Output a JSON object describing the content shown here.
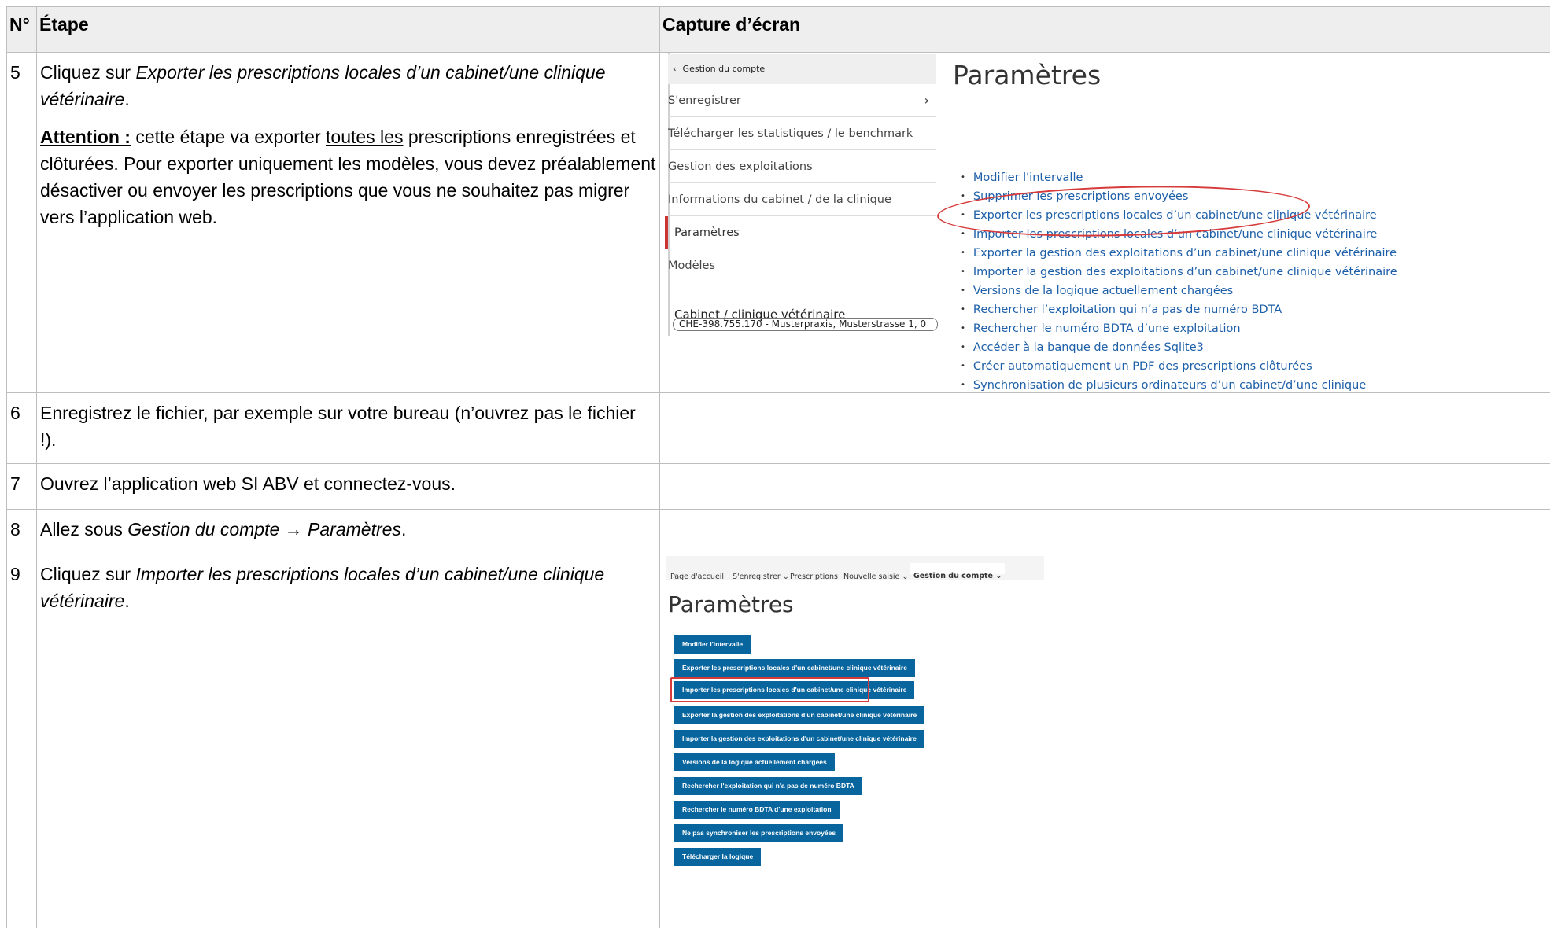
{
  "table": {
    "headers": {
      "num": "N°",
      "step": "Étape",
      "screenshot": "Capture d’écran"
    },
    "rows": [
      {
        "num": "5",
        "step_pre": "Cliquez sur ",
        "step_em": "Exporter les prescriptions locales d’un cabinet/une clinique vétérinaire",
        "step_post": ".",
        "attention_label": "Attention :",
        "attention_text_a": " cette étape va exporter ",
        "attention_underline": "toutes les",
        "attention_text_b": " prescriptions enregistrées et clôturées. Pour exporter uniquement les modèles, vous devez préalablement désactiver ou envoyer les prescriptions que vous ne souhaitez pas migrer vers l’application web."
      },
      {
        "num": "6",
        "step": "Enregistrez le fichier, par exemple sur votre bureau (n’ouvrez pas le fichier !)."
      },
      {
        "num": "7",
        "step": "Ouvrez l’application web SI ABV et connectez-vous."
      },
      {
        "num": "8",
        "step_pre": "Allez sous ",
        "step_em": "Gestion du compte → Paramètres",
        "step_post": "."
      },
      {
        "num": "9",
        "step_pre": "Cliquez sur ",
        "step_em": "Importer les prescriptions locales d’un cabinet/une clinique vétérinaire",
        "step_post": "."
      }
    ]
  },
  "screenshot1": {
    "sidebar_header": "Gestion du compte",
    "sidebar_items": [
      "S'enregistrer",
      "Télécharger les statistiques / le benchmark",
      "Gestion des exploitations",
      "Informations du cabinet / de la clinique",
      "Paramètres",
      "Modèles"
    ],
    "cabinet_label": "Cabinet / clinique vétérinaire",
    "cabinet_value": "CHE-398.755.170 - Musterpraxis, Musterstrasse 1, 0",
    "title": "Paramètres",
    "links": [
      "Modifier l'intervalle",
      "Supprimer les prescriptions envoyées",
      "Exporter les prescriptions locales d’un cabinet/une clinique vétérinaire",
      "Importer les prescriptions locales d’un cabinet/une clinique vétérinaire",
      "Exporter la gestion des exploitations d’un cabinet/une clinique vétérinaire",
      "Importer la gestion des exploitations d’un cabinet/une clinique vétérinaire",
      "Versions de la logique actuellement chargées",
      "Rechercher l’exploitation qui n’a pas de numéro BDTA",
      "Rechercher le numéro BDTA d’une exploitation",
      "Accéder à la banque de données Sqlite3",
      "Créer automatiquement un PDF des prescriptions clôturées",
      "Synchronisation de plusieurs ordinateurs d’un cabinet/d’une clinique"
    ]
  },
  "screenshot2": {
    "nav": [
      "Page d'accueil",
      "S'enregistrer",
      "Prescriptions",
      "Nouvelle saisie",
      "Gestion du compte"
    ],
    "title": "Paramètres",
    "buttons": [
      "Modifier l'intervalle",
      "Exporter les prescriptions locales d'un cabinet/une clinique vétérinaire",
      "Importer les prescriptions locales d'un cabinet/une clinique vétérinaire",
      "Exporter la gestion des exploitations d'un cabinet/une clinique vétérinaire",
      "Importer la gestion des exploitations d'un cabinet/une clinique vétérinaire",
      "Versions de la logique actuellement chargées",
      "Rechercher l'exploitation qui n'a pas de numéro BDTA",
      "Rechercher le numéro BDTA d'une exploitation",
      "Ne pas synchroniser les prescriptions envoyées",
      "Télécharger la logique"
    ]
  },
  "colors": {
    "link": "#1d5fa8",
    "button": "#08659e",
    "highlight": "#d63a3a",
    "header_bg": "#eeeeee"
  }
}
